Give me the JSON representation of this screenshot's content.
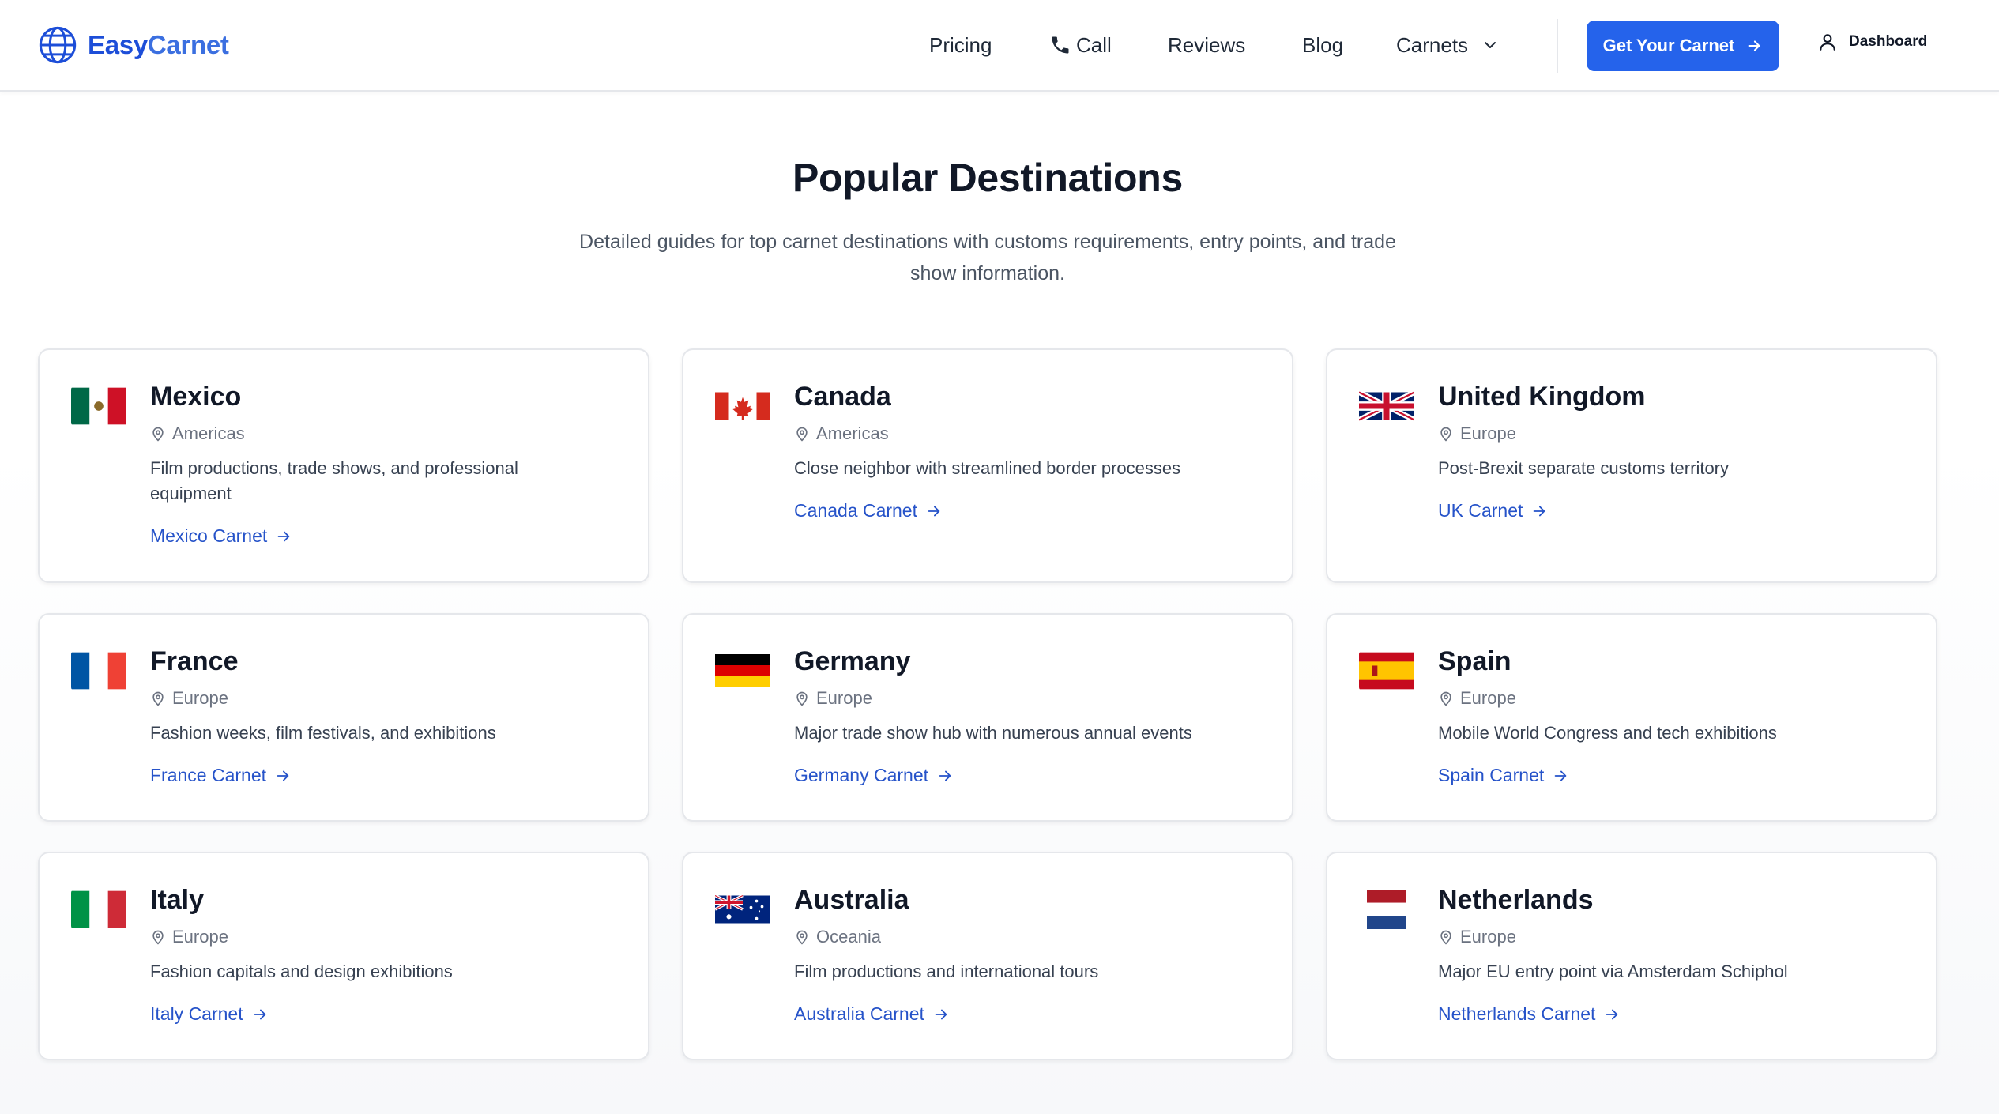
{
  "brand": {
    "name_part1": "Easy",
    "name_part2": "Carnet"
  },
  "nav": {
    "pricing": "Pricing",
    "call": "Call",
    "reviews": "Reviews",
    "blog": "Blog",
    "carnets": "Carnets",
    "cta": "Get Your Carnet",
    "dashboard": "Dashboard"
  },
  "section": {
    "title": "Popular Destinations",
    "subtitle": "Detailed guides for top carnet destinations with customs requirements, entry points, and trade show information."
  },
  "destinations": [
    {
      "country": "Mexico",
      "region": "Americas",
      "description": "Film productions, trade shows, and professional equipment",
      "link": "Mexico Carnet",
      "flag": "mexico-flag-icon"
    },
    {
      "country": "Canada",
      "region": "Americas",
      "description": "Close neighbor with streamlined border processes",
      "link": "Canada Carnet",
      "flag": "canada-flag-icon"
    },
    {
      "country": "United Kingdom",
      "region": "Europe",
      "description": "Post-Brexit separate customs territory",
      "link": "UK Carnet",
      "flag": "uk-flag-icon"
    },
    {
      "country": "France",
      "region": "Europe",
      "description": "Fashion weeks, film festivals, and exhibitions",
      "link": "France Carnet",
      "flag": "france-flag-icon"
    },
    {
      "country": "Germany",
      "region": "Europe",
      "description": "Major trade show hub with numerous annual events",
      "link": "Germany Carnet",
      "flag": "germany-flag-icon"
    },
    {
      "country": "Spain",
      "region": "Europe",
      "description": "Mobile World Congress and tech exhibitions",
      "link": "Spain Carnet",
      "flag": "spain-flag-icon"
    },
    {
      "country": "Italy",
      "region": "Europe",
      "description": "Fashion capitals and design exhibitions",
      "link": "Italy Carnet",
      "flag": "italy-flag-icon"
    },
    {
      "country": "Australia",
      "region": "Oceania",
      "description": "Film productions and international tours",
      "link": "Australia Carnet",
      "flag": "australia-flag-icon"
    },
    {
      "country": "Netherlands",
      "region": "Europe",
      "description": "Major EU entry point via Amsterdam Schiphol",
      "link": "Netherlands Carnet",
      "flag": "netherlands-flag-icon"
    }
  ],
  "colors": {
    "accent": "#2563eb",
    "link": "#2653c9",
    "brand": "#1d4ed8"
  }
}
